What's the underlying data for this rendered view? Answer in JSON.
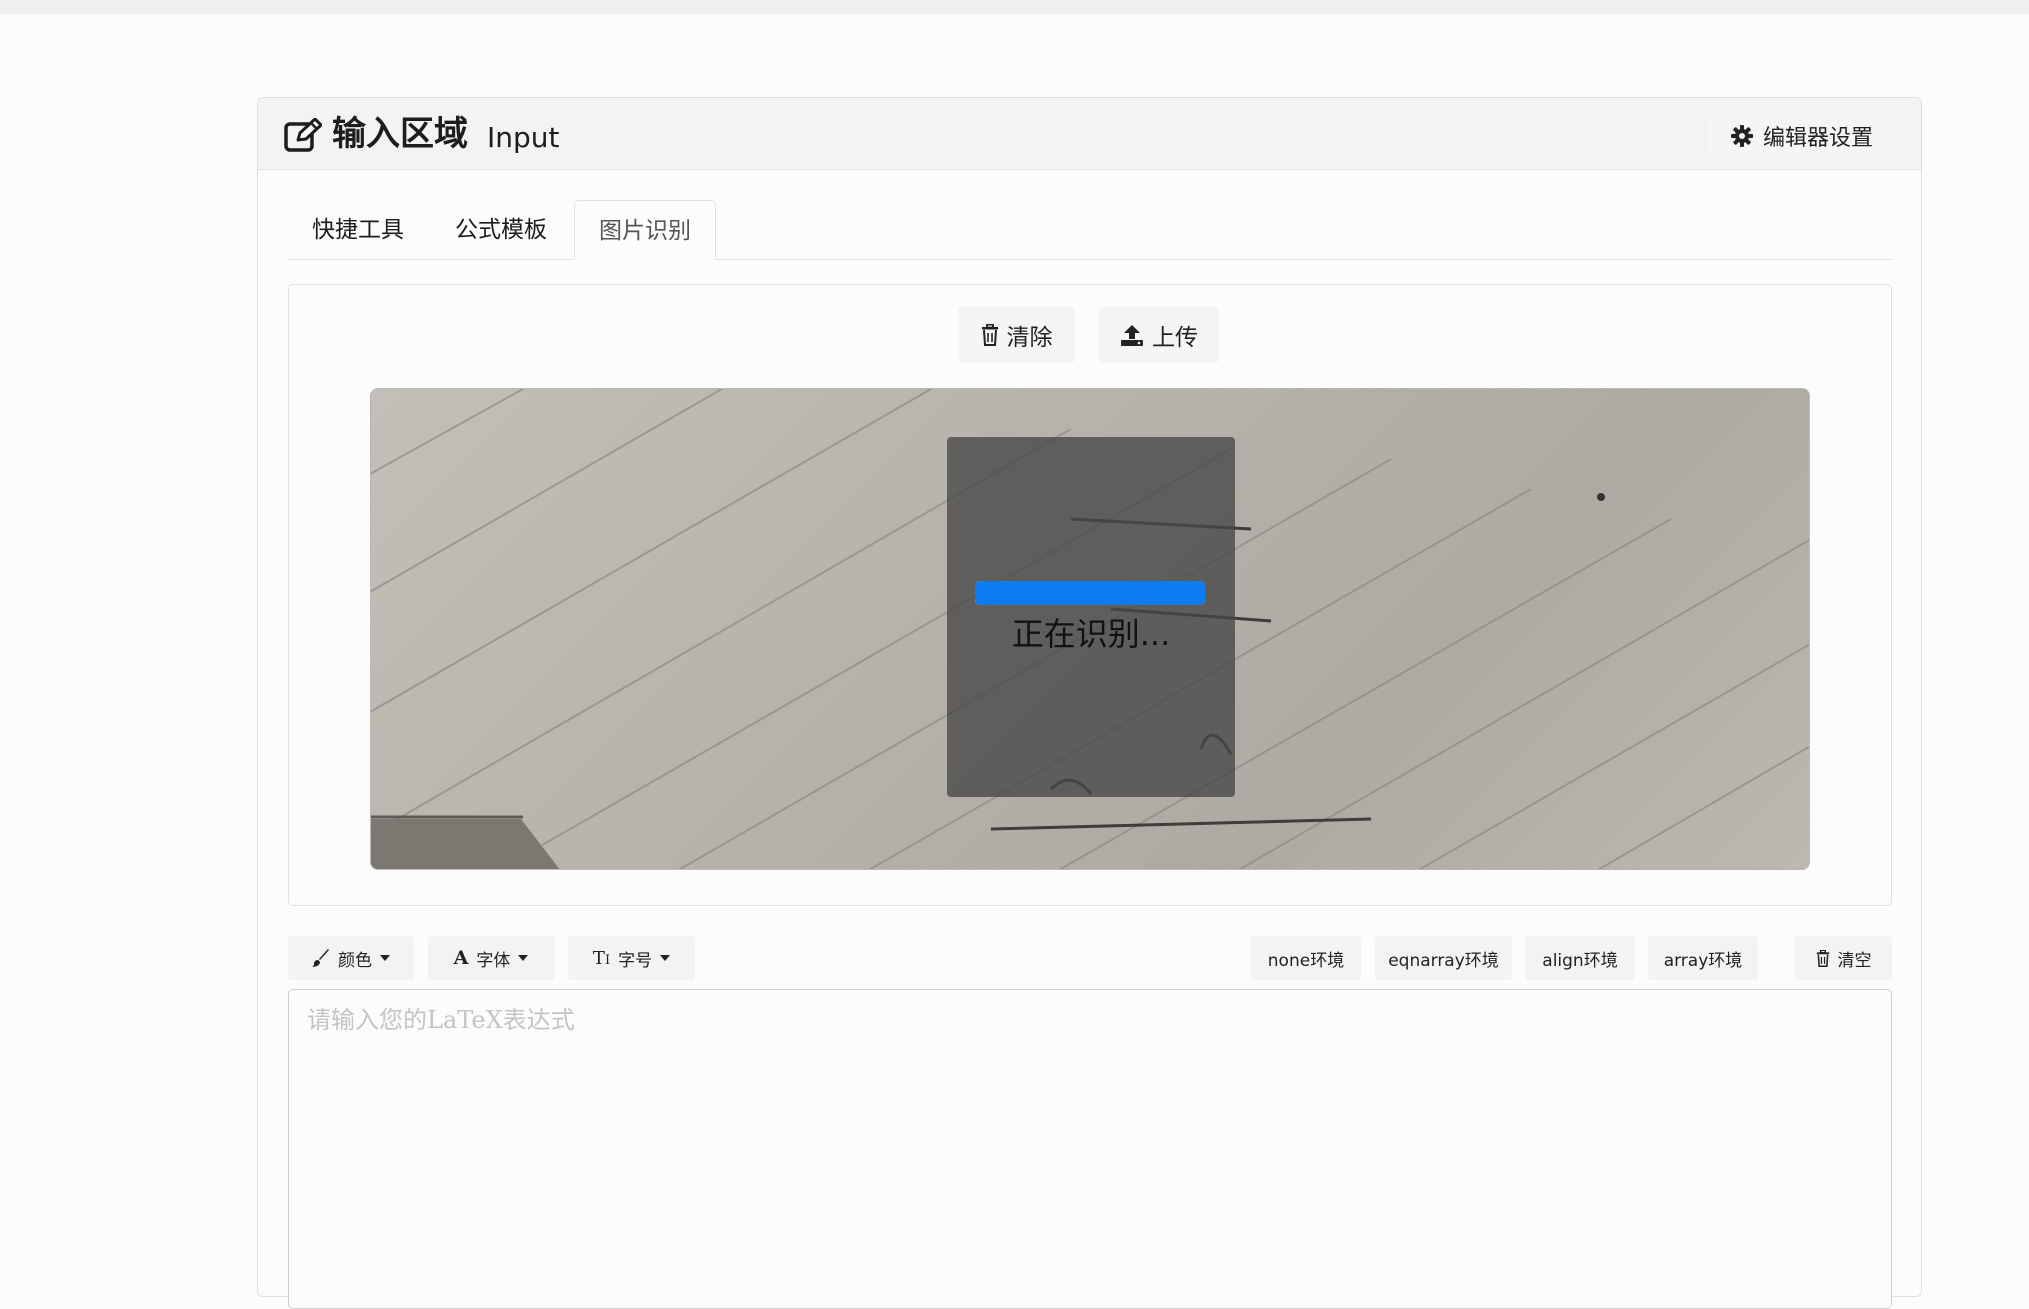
{
  "panel": {
    "title": "输入区域",
    "subtitle": "Input",
    "settings_label": "编辑器设置"
  },
  "tabs": [
    {
      "label": "快捷工具",
      "active": false
    },
    {
      "label": "公式模板",
      "active": false
    },
    {
      "label": "图片识别",
      "active": true
    }
  ],
  "ocr": {
    "clear_label": "清除",
    "upload_label": "上传",
    "status_text": "正在识别...",
    "progress": 1.0,
    "progress_color": "#0d7bf2"
  },
  "toolbar": {
    "color_label": "颜色",
    "font_label": "字体",
    "size_label": "字号",
    "env_none": "none环境",
    "env_eqnarray": "eqnarray环境",
    "env_align": "align环境",
    "env_array": "array环境",
    "clear_all_label": "清空"
  },
  "editor": {
    "placeholder": "请输入您的LaTeX表达式",
    "value": ""
  },
  "colors": {
    "accent": "#0d7bf2",
    "header_bg": "#f3f3f3",
    "button_bg": "#f5f5f5"
  }
}
